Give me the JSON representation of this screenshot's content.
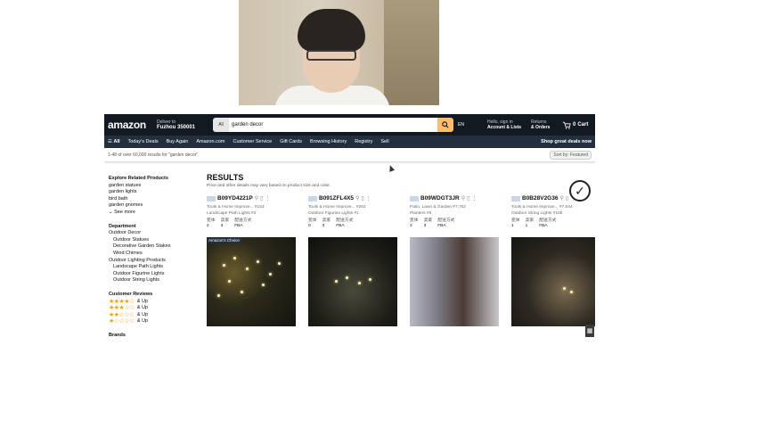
{
  "header": {
    "logo": "amazon",
    "deliver_line1": "Deliver to",
    "deliver_line2": "Fuzhou 350001",
    "search_category": "All",
    "search_value": "garden decor",
    "language": "EN",
    "account_line1": "Hello, sign in",
    "account_line2": "Account & Lists",
    "orders_line1": "Returns",
    "orders_line2": "& Orders",
    "cart_count": "0",
    "cart_label": "Cart"
  },
  "nav": {
    "all": "All",
    "items": [
      "Today's Deals",
      "Buy Again",
      "Amazon.com",
      "Customer Service",
      "Gift Cards",
      "Browsing History",
      "Registry",
      "Sell"
    ],
    "promo": "Shop great deals now"
  },
  "results_bar": {
    "summary": "1-48 of over 60,000 results for \"garden decor\"",
    "sort": "Sort by: Featured"
  },
  "sidebar": {
    "related_heading": "Explore Related Products",
    "related": [
      "garden statues",
      "garden lights",
      "bird bath",
      "garden gnomes"
    ],
    "see_more": "See more",
    "department_heading": "Department",
    "departments": [
      {
        "label": "Outdoor Decor",
        "sub": [
          "Outdoor Statues",
          "Decorative Garden Stakes",
          "Wind Chimes"
        ]
      },
      {
        "label": "Outdoor Lighting Products",
        "sub": [
          "Landscape Path Lights",
          "Outdoor Figurine Lights",
          "Outdoor String Lights"
        ]
      }
    ],
    "reviews_heading": "Customer Reviews",
    "reviews": [
      {
        "stars": "★★★★☆",
        "label": "& Up"
      },
      {
        "stars": "★★★☆☆",
        "label": "& Up"
      },
      {
        "stars": "★★☆☆☆",
        "label": "& Up"
      },
      {
        "stars": "★☆☆☆☆",
        "label": "& Up"
      }
    ],
    "brands_heading": "Brands"
  },
  "main": {
    "title": "RESULTS",
    "note": "Price and other details may vary based on product size and color.",
    "products": [
      {
        "asin": "B09YD4221P",
        "rank_cat": "Tools & Home Improve...",
        "rank": "#153",
        "sub_cat": "Landscape Path Lights #2",
        "col1_label": "变体",
        "col1_val": "2",
        "col2_label": "卖家",
        "col2_val": "3",
        "col3_label": "配送方式",
        "col3_val": "FBA",
        "badge": "Amazon's Choice"
      },
      {
        "asin": "B091ZFL4X5",
        "rank_cat": "Tools & Home Improve...",
        "rank": "#263",
        "sub_cat": "Outdoor Figurine Lights #1",
        "col1_label": "变体",
        "col1_val": "0",
        "col2_label": "卖家",
        "col2_val": "3",
        "col3_label": "配送方式",
        "col3_val": "FBA",
        "badge": ""
      },
      {
        "asin": "B09WDGT3JR",
        "rank_cat": "Patio, Lawn & Garden",
        "rank": "#7,702",
        "sub_cat": "Planters #9",
        "col1_label": "变体",
        "col1_val": "2",
        "col2_label": "卖家",
        "col2_val": "3",
        "col3_label": "配送方式",
        "col3_val": "FBA",
        "badge": ""
      },
      {
        "asin": "B0B28V2G36",
        "rank_cat": "Tools & Home Improve...",
        "rank": "#7,044",
        "sub_cat": "Outdoor String Lights #105",
        "col1_label": "变体",
        "col1_val": "1",
        "col2_label": "卖家",
        "col2_val": "1",
        "col3_label": "配送方式",
        "col3_val": "FBA",
        "badge": ""
      }
    ]
  },
  "colors": {
    "topbar": "#131921",
    "navbar": "#232f3e",
    "search_button": "#febd69",
    "link": "#007185",
    "star": "#f2a000"
  },
  "icons": {
    "search": "search-icon",
    "cart": "cart-icon",
    "hamburger": "menu-icon",
    "check": "check-circle-icon"
  }
}
